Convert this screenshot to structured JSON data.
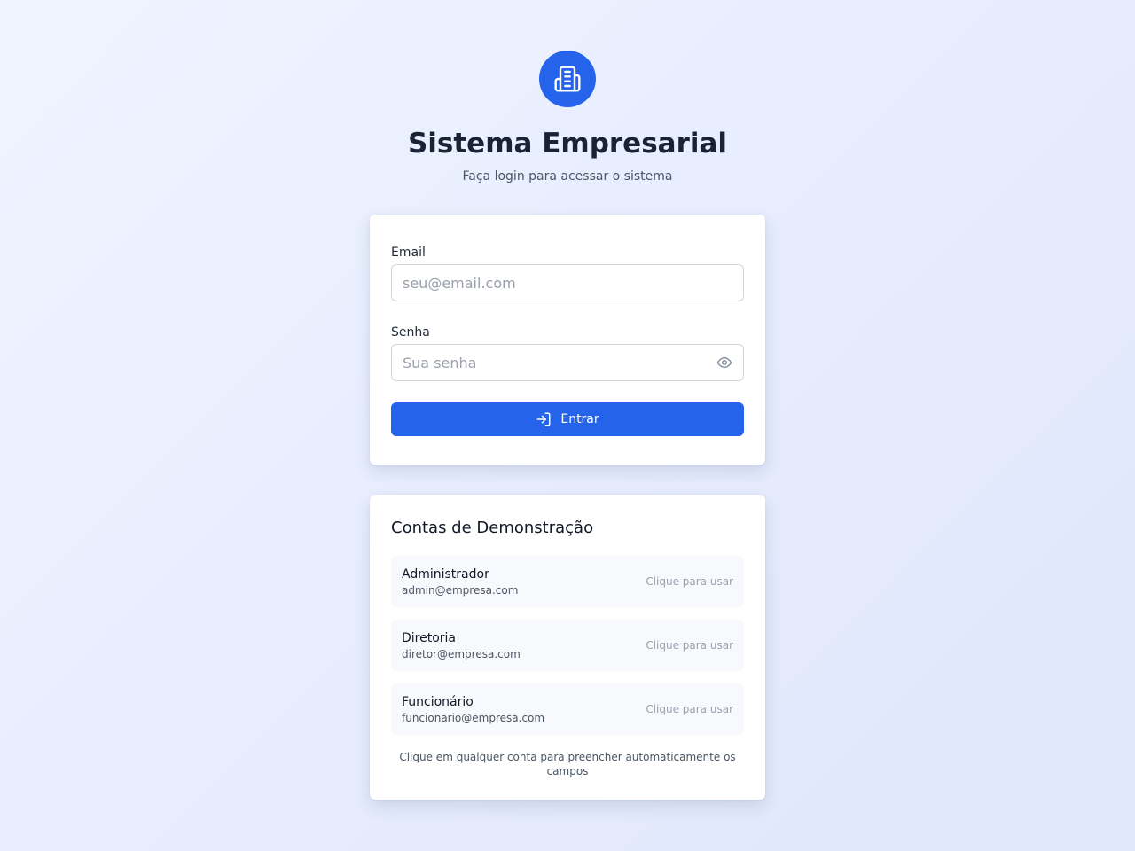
{
  "header": {
    "logo_icon": "building-icon",
    "title": "Sistema Empresarial",
    "subtitle": "Faça login para acessar o sistema"
  },
  "login": {
    "email_label": "Email",
    "email_placeholder": "seu@email.com",
    "email_value": "",
    "password_label": "Senha",
    "password_placeholder": "Sua senha",
    "password_value": "",
    "show_password_icon": "eye-icon",
    "submit_icon": "login-icon",
    "submit_label": "Entrar"
  },
  "demo": {
    "title": "Contas de Demonstração",
    "accounts": [
      {
        "name": "Administrador",
        "email": "admin@empresa.com",
        "hint": "Clique para usar"
      },
      {
        "name": "Diretoria",
        "email": "diretor@empresa.com",
        "hint": "Clique para usar"
      },
      {
        "name": "Funcionário",
        "email": "funcionario@empresa.com",
        "hint": "Clique para usar"
      }
    ],
    "footnote": "Clique em qualquer conta para preencher automaticamente os campos"
  },
  "colors": {
    "primary": "#2563eb",
    "heading": "#1a2233",
    "muted": "#4b5563",
    "placeholder": "#9aa1ad"
  }
}
